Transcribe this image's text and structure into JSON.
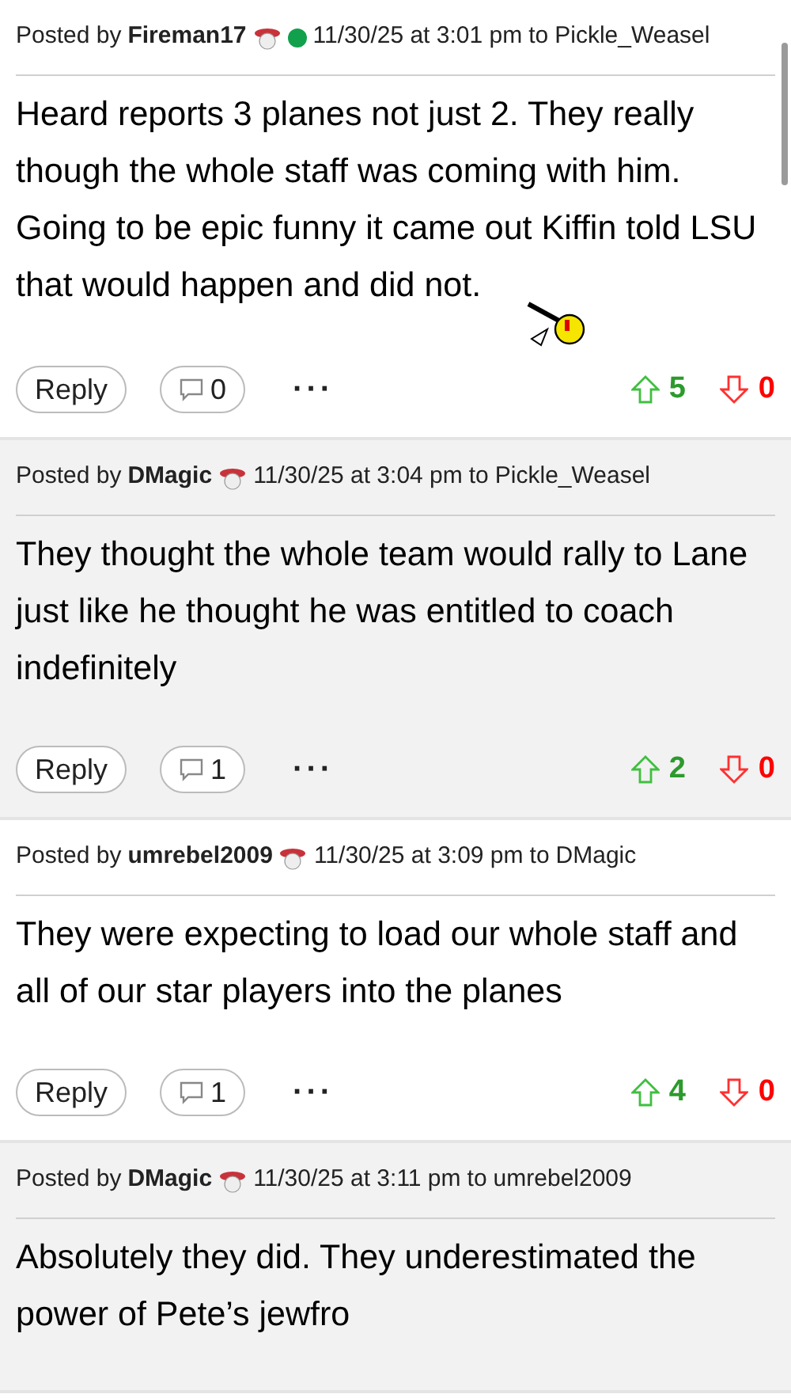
{
  "posts": [
    {
      "author": "Fireman17",
      "online": true,
      "time": "11/30/25 at 3:01 pm",
      "to": "Pickle_Weasel",
      "posted_by": "Posted by",
      "to_label": "to",
      "body": "Heard reports 3 planes not just 2. They really though the whole staff was coming with him. Going to be epic funny it came out Kiffin told LSU that would happen and did not.",
      "emoticon": true,
      "reply": "Reply",
      "comments": "0",
      "more": "···",
      "up": "5",
      "down": "0",
      "shaded": false
    },
    {
      "author": "DMagic",
      "online": false,
      "time": "11/30/25 at 3:04 pm",
      "to": "Pickle_Weasel",
      "posted_by": "Posted by",
      "to_label": "to",
      "body": "They thought the whole team would rally to Lane just like he thought he was entitled to coach indefinitely",
      "emoticon": false,
      "reply": "Reply",
      "comments": "1",
      "more": "···",
      "up": "2",
      "down": "0",
      "shaded": true
    },
    {
      "author": "umrebel2009",
      "online": false,
      "time": "11/30/25 at 3:09 pm",
      "to": "DMagic",
      "posted_by": "Posted by",
      "to_label": "to",
      "body": "They were expecting to load our whole staff and all of our star players into the planes",
      "emoticon": false,
      "reply": "Reply",
      "comments": "1",
      "more": "···",
      "up": "4",
      "down": "0",
      "shaded": false
    },
    {
      "author": "DMagic",
      "online": false,
      "time": "11/30/25 at 3:11 pm",
      "to": "umrebel2009",
      "posted_by": "Posted by",
      "to_label": "to",
      "body": "Absolutely they did. They underestimated the power of Pete’s jewfro",
      "emoticon": false,
      "shaded": true
    }
  ]
}
